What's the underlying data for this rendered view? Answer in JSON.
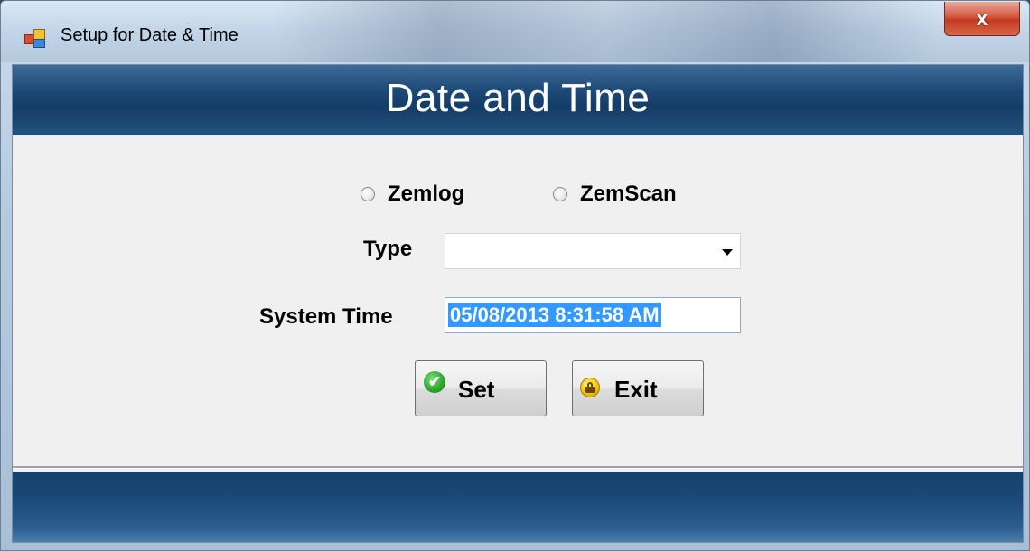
{
  "window": {
    "title": "Setup for Date & Time",
    "close_glyph": "x",
    "app_icon": "app-icon"
  },
  "header": {
    "title": "Date and Time"
  },
  "device_options": [
    {
      "label": "Zemlog",
      "selected": false
    },
    {
      "label": "ZemScan",
      "selected": false
    }
  ],
  "type_field": {
    "label": "Type",
    "value": ""
  },
  "system_time": {
    "label": "System Time",
    "value": "05/08/2013 8:31:58 AM"
  },
  "buttons": {
    "set_label": "Set",
    "exit_label": "Exit",
    "set_icon": "check-icon",
    "exit_icon": "lock-icon"
  },
  "colors": {
    "header_band": "#1e4a78",
    "selection": "#3399ff",
    "client_bg": "#f0f0f0"
  }
}
